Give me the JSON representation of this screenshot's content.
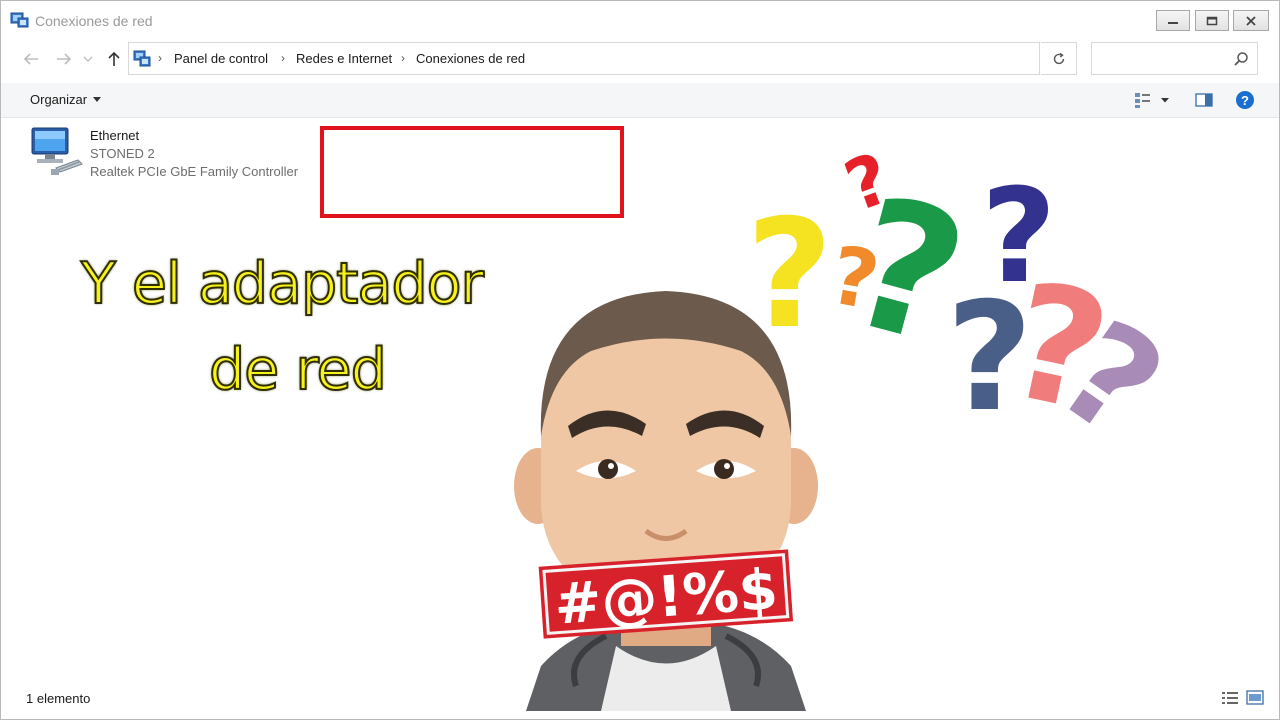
{
  "window": {
    "title": "Conexiones de red"
  },
  "breadcrumb": [
    "Panel de control",
    "Redes e Internet",
    "Conexiones de red"
  ],
  "search": {
    "placeholder": ""
  },
  "toolbar": {
    "organize_label": "Organizar"
  },
  "connection": {
    "name": "Ethernet",
    "network": "STONED 2",
    "adapter": "Realtek PCIe GbE Family Controller"
  },
  "overlay": {
    "caption_line1": "Y el adaptador",
    "caption_line2": "de red",
    "censor_text": "#@!%$",
    "caption_color": "#f7f21d",
    "highlight_color": "#e0121a",
    "question_mark_colors": [
      "#f5e321",
      "#e7212a",
      "#f08a2a",
      "#1a9a48",
      "#33338f",
      "#4a5f87",
      "#f07c7c",
      "#a98bb8"
    ]
  },
  "status": {
    "count": "1 elemento"
  },
  "icons": [
    "network-connections-icon",
    "back-arrow-icon",
    "forward-arrow-icon",
    "up-arrow-icon",
    "refresh-icon",
    "search-icon",
    "help-icon",
    "ethernet-adapter-icon"
  ]
}
